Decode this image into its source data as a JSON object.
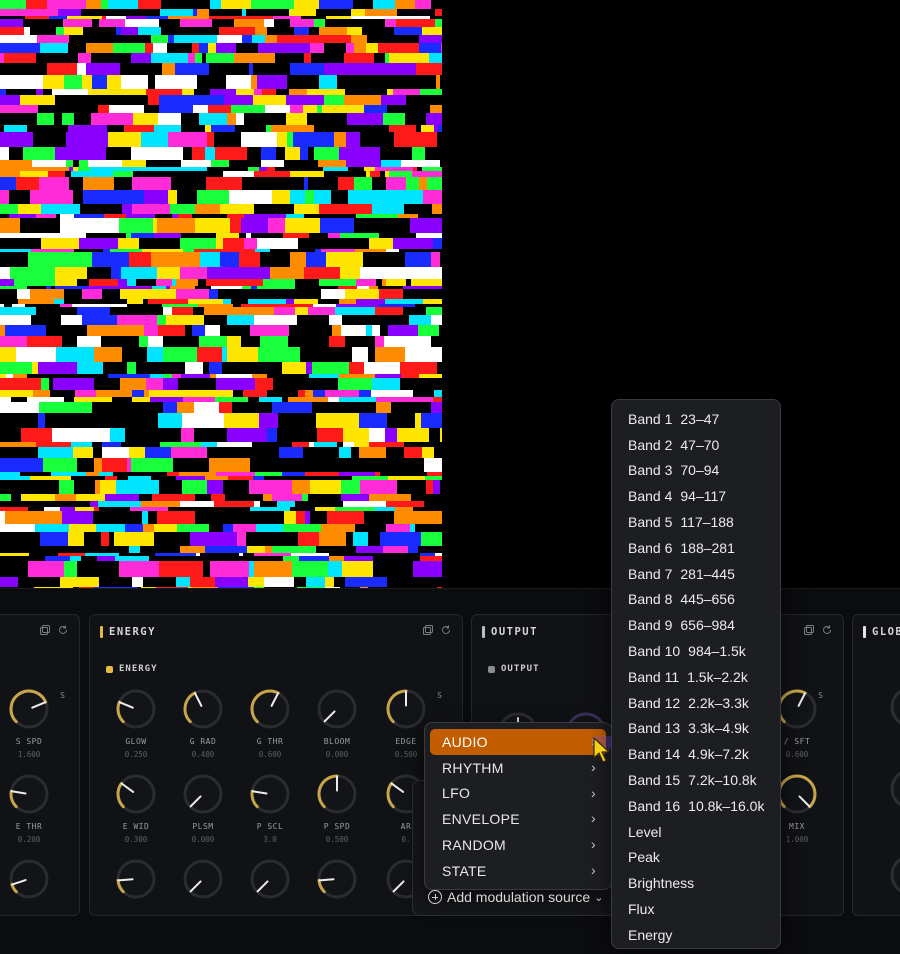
{
  "cards": {
    "left_partial": {
      "knobs": [
        {
          "name": "S SPD",
          "value": "1.600",
          "level": 0.75
        },
        {
          "name": "E THR",
          "value": "0.200",
          "level": 0.2
        },
        {
          "name": "",
          "value": "",
          "level": 0.1
        }
      ]
    },
    "energy": {
      "title": "ENERGY",
      "section": "ENERGY",
      "s_tag": "S",
      "rows": [
        [
          {
            "name": "GLOW",
            "value": "0.250",
            "level": 0.25
          },
          {
            "name": "G RAD",
            "value": "0.400",
            "level": 0.4
          },
          {
            "name": "G THR",
            "value": "0.600",
            "level": 0.6
          },
          {
            "name": "BLOOM",
            "value": "0.000",
            "level": 0.0
          },
          {
            "name": "EDGE",
            "value": "0.500",
            "level": 0.5
          }
        ],
        [
          {
            "name": "E WID",
            "value": "0.300",
            "level": 0.3
          },
          {
            "name": "PLSM",
            "value": "0.000",
            "level": 0.0
          },
          {
            "name": "P SCL",
            "value": "3.0",
            "level": 0.2
          },
          {
            "name": "P SPD",
            "value": "0.500",
            "level": 0.5
          },
          {
            "name": "AR",
            "value": "0.",
            "level": 0.3
          }
        ],
        [
          {
            "name": "",
            "value": "",
            "level": 0.15
          },
          {
            "name": "",
            "value": "",
            "level": 0.0
          },
          {
            "name": "",
            "value": "",
            "level": 0.0
          },
          {
            "name": "",
            "value": "",
            "level": 0.15
          },
          {
            "name": "",
            "value": "",
            "level": 0.0
          }
        ]
      ]
    },
    "output": {
      "title": "OUTPUT",
      "section": "OUTPUT"
    },
    "right_partial": {
      "s_tag": "S",
      "knobs": [
        {
          "name": "/ SFT",
          "value": "0.600",
          "level": 0.6
        },
        {
          "name": "MIX",
          "value": "1.000",
          "level": 1.0
        }
      ]
    },
    "global": {
      "title": "GLOB"
    }
  },
  "modulation_menu": {
    "categories": [
      {
        "label": "AUDIO",
        "active": true
      },
      {
        "label": "RHYTHM",
        "active": false
      },
      {
        "label": "LFO",
        "active": false
      },
      {
        "label": "ENVELOPE",
        "active": false
      },
      {
        "label": "RANDOM",
        "active": false
      },
      {
        "label": "STATE",
        "active": false
      }
    ],
    "add_label": "Add modulation source"
  },
  "audio_submenu": {
    "bands": [
      {
        "label": "Band 1",
        "range": "23–47"
      },
      {
        "label": "Band 2",
        "range": "47–70"
      },
      {
        "label": "Band 3",
        "range": "70–94"
      },
      {
        "label": "Band 4",
        "range": "94–117"
      },
      {
        "label": "Band 5",
        "range": "117–188"
      },
      {
        "label": "Band 6",
        "range": "188–281"
      },
      {
        "label": "Band 7",
        "range": "281–445"
      },
      {
        "label": "Band 8",
        "range": "445–656"
      },
      {
        "label": "Band 9",
        "range": "656–984"
      },
      {
        "label": "Band 10",
        "range": "984–1.5k"
      },
      {
        "label": "Band 11",
        "range": "1.5k–2.2k"
      },
      {
        "label": "Band 12",
        "range": "2.2k–3.3k"
      },
      {
        "label": "Band 13",
        "range": "3.3k–4.9k"
      },
      {
        "label": "Band 14",
        "range": "4.9k–7.2k"
      },
      {
        "label": "Band 15",
        "range": "7.2k–10.8k"
      },
      {
        "label": "Band 16",
        "range": "10.8k–16.0k"
      }
    ],
    "extras": [
      "Level",
      "Peak",
      "Brightness",
      "Flux",
      "Energy"
    ]
  },
  "colors": {
    "accent": "#e8ba3d",
    "menu_active": "#c25e00",
    "knob_arc": "#c9a54a"
  }
}
